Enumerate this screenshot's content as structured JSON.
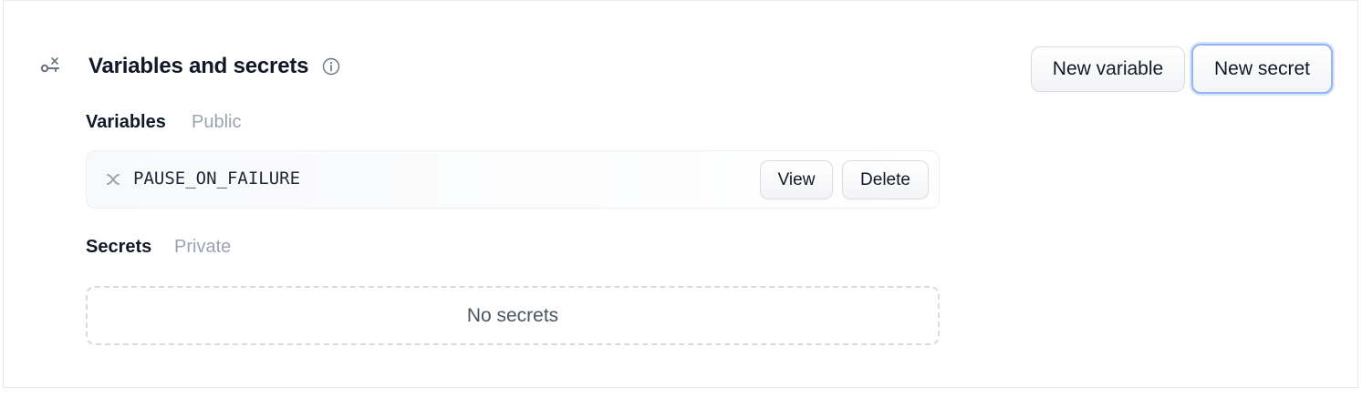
{
  "section": {
    "title": "Variables and secrets",
    "icon": "key-variable-icon",
    "info_icon": "info-icon"
  },
  "actions": {
    "new_variable_label": "New variable",
    "new_secret_label": "New secret"
  },
  "variables": {
    "label": "Variables",
    "visibility": "Public",
    "items": [
      {
        "name": "PAUSE_ON_FAILURE",
        "icon": "variable-x-icon",
        "view_label": "View",
        "delete_label": "Delete"
      }
    ]
  },
  "secrets": {
    "label": "Secrets",
    "visibility": "Private",
    "empty_text": "No secrets"
  },
  "colors": {
    "focus_ring": "#93b4f5",
    "muted_text": "#9ca3af",
    "border": "#e5e7eb"
  }
}
